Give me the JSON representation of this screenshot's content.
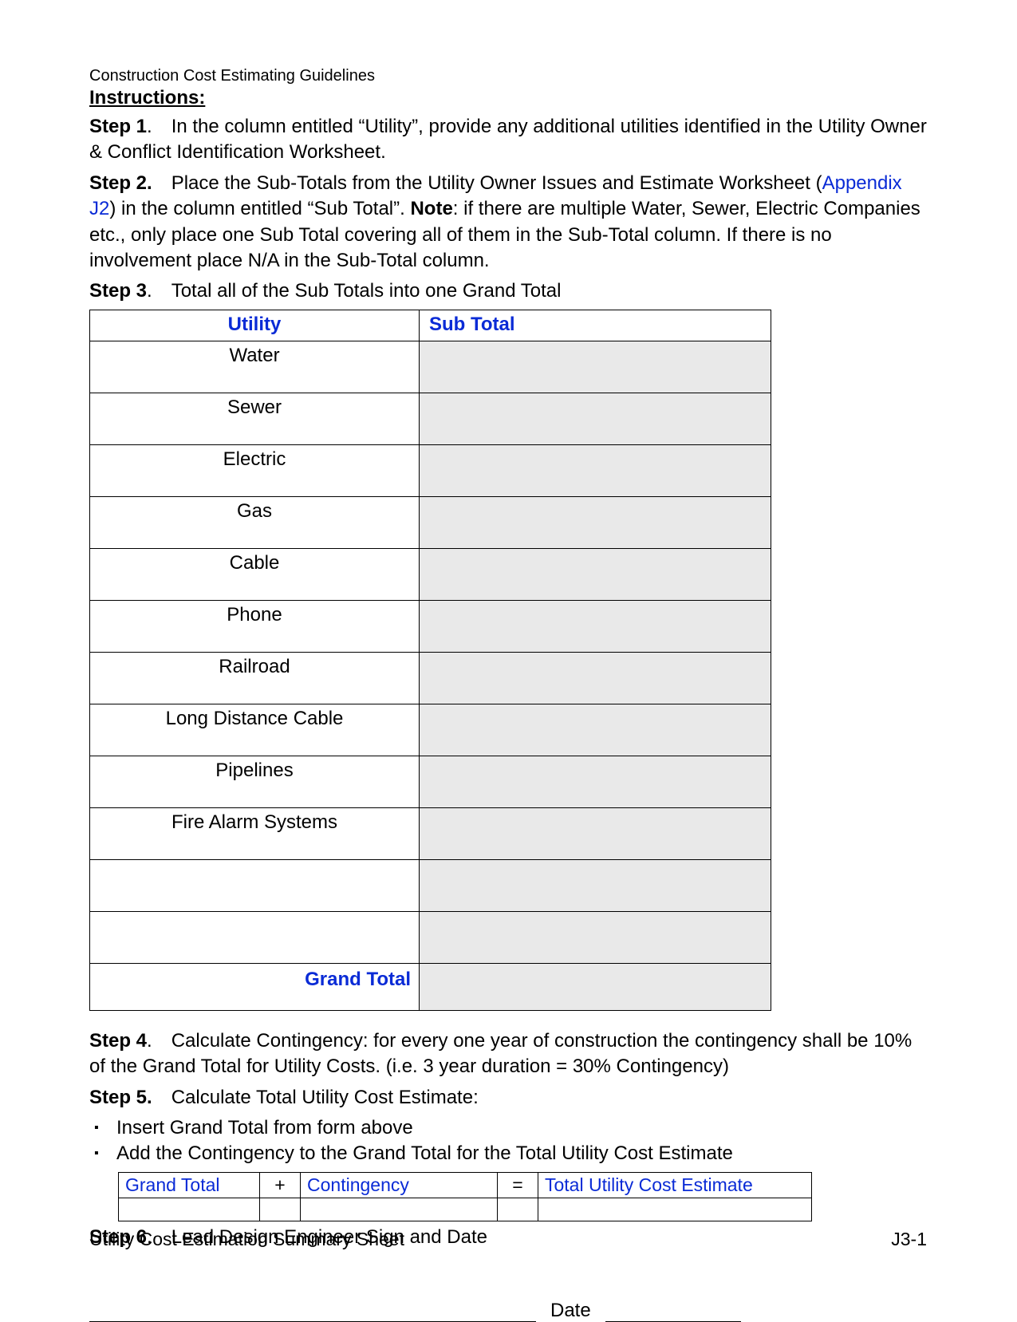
{
  "doc_header": "Construction Cost Estimating Guidelines",
  "instructions_label": "Instructions:",
  "steps": {
    "s1_label": "Step 1",
    "s1_text": ". In the column entitled “Utility”, provide any additional utilities identified in the Utility Owner & Conflict Identification Worksheet.",
    "s2_label": "Step 2.",
    "s2_text_a": " Place the Sub-Totals from the Utility Owner Issues and Estimate Worksheet (",
    "s2_link": "Appendix J2",
    "s2_text_b": ") in the column entitled “Sub Total”. ",
    "s2_note_label": "Note",
    "s2_text_c": ": if there are multiple Water, Sewer, Electric Companies etc., only place one Sub Total covering all of them in the Sub-Total column. If there is no involvement place N/A in the Sub-Total column.",
    "s3_label": "Step 3",
    "s3_text": ". Total all of the Sub Totals into one Grand Total",
    "s4_label": "Step 4",
    "s4_text": ". Calculate Contingency: for every one year of construction the contingency shall be 10% of the Grand Total for Utility Costs. (i.e. 3 year duration = 30% Contingency)",
    "s5_label": "Step 5.",
    "s5_text": " Calculate Total Utility Cost Estimate:",
    "s5_b1": "Insert Grand Total from form above",
    "s5_b2": "Add the Contingency to the Grand Total for the Total Utility Cost Estimate",
    "s6_label": "Step 6",
    "s6_text": ". Lead Design Engineer Sign and Date"
  },
  "util_table": {
    "head_utility": "Utility",
    "head_subtotal": "Sub Total",
    "rows": [
      "Water",
      "Sewer",
      "Electric",
      "Gas",
      "Cable",
      "Phone",
      "Railroad",
      "Long Distance Cable",
      "Pipelines",
      "Fire Alarm Systems",
      "",
      ""
    ],
    "grand_total_label": "Grand Total"
  },
  "calc_table": {
    "c1": "Grand Total",
    "op1": "+",
    "c2": "Contingency",
    "op2": "=",
    "c3": "Total Utility Cost Estimate"
  },
  "date_label": "Date",
  "footer_left": "Utility Cost Estimation Summary Sheet",
  "footer_right": "J3-1"
}
